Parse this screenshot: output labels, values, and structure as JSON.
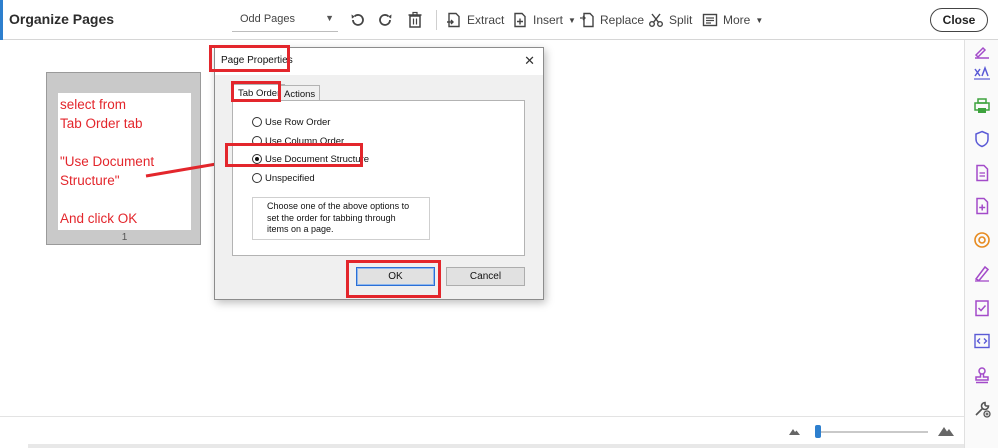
{
  "toolbar": {
    "title": "Organize Pages",
    "page_filter": "Odd Pages",
    "extract_label": "Extract",
    "insert_label": "Insert",
    "replace_label": "Replace",
    "split_label": "Split",
    "more_label": "More",
    "close_label": "Close"
  },
  "thumbnail": {
    "annotation_text": "select from\nTab Order tab\n\n\"Use Document\nStructure\"\n\nAnd click OK",
    "page_number": "1"
  },
  "dialog": {
    "title": "Page Properties",
    "close_glyph": "✕",
    "tabs": [
      {
        "label": "Tab Order",
        "active": true
      },
      {
        "label": "Actions",
        "active": false
      }
    ],
    "options": [
      {
        "label": "Use Row Order",
        "checked": false
      },
      {
        "label": "Use Column Order",
        "checked": false
      },
      {
        "label": "Use Document Structure",
        "checked": true
      },
      {
        "label": "Unspecified",
        "checked": false
      }
    ],
    "hint": "Choose one of the above options to\nset the order for tabbing through\nitems on a page.",
    "ok_label": "OK",
    "cancel_label": "Cancel"
  },
  "colors": {
    "accent": "#2d7fce",
    "annotation_red": "#e3262c",
    "rail_purple": "#a34bc9",
    "rail_green": "#3ea33e",
    "rail_orange": "#e68a1f",
    "rail_blue": "#5a5ad6"
  },
  "right_rail_icons": [
    "fill-sign-icon",
    "edit-text-icon",
    "print-export-icon",
    "protect-shield-icon",
    "create-pdf-icon",
    "add-pdf-icon",
    "optimize-icon",
    "sign-pen-icon",
    "checklist-icon",
    "code-icon",
    "stamp-icon",
    "tools-icon"
  ]
}
